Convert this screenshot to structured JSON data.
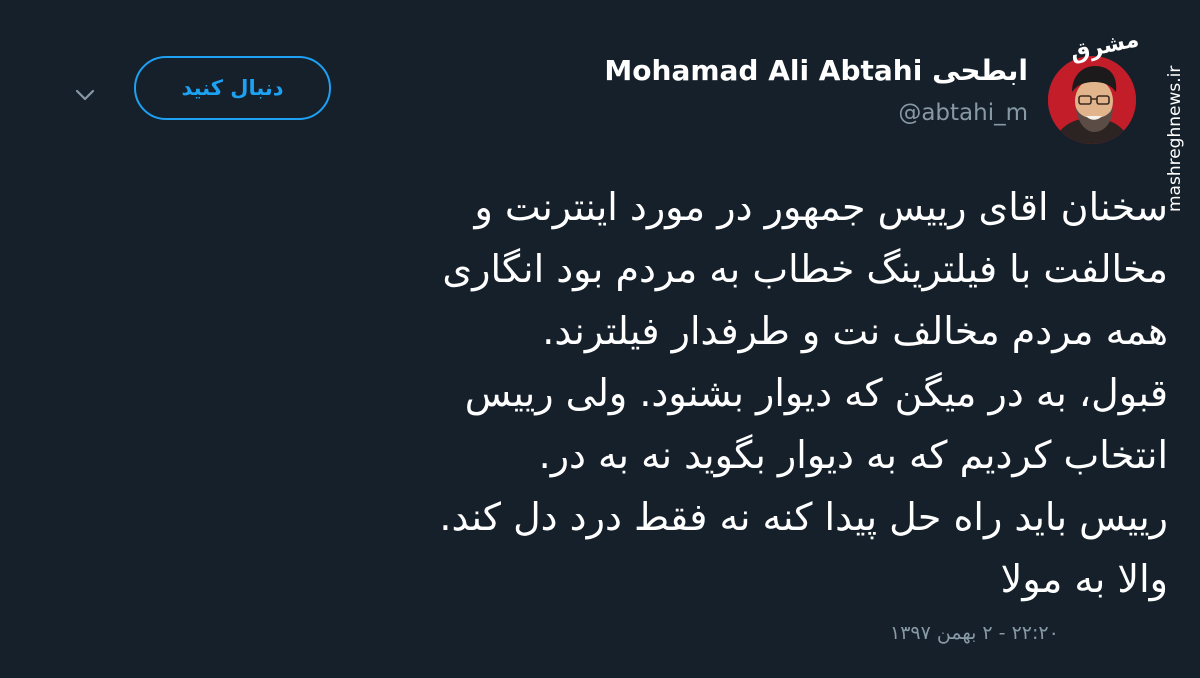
{
  "header": {
    "display_name": "Mohamad Ali Abtahi ابطحی",
    "handle": "@abtahi_m",
    "follow_label": "دنبال کنید"
  },
  "tweet": {
    "lines": [
      "سخنان اقای رییس جمهور در مورد اینترنت و",
      "مخالفت با فیلترینگ خطاب به مردم بود انگاری",
      "همه مردم مخالف نت و طرفدار فیلترند.",
      "قبول، به در میگن که دیوار بشنود. ولی رییس",
      "انتخاب کردیم که به دیوار بگوید نه به در.",
      "رییس باید راه حل پیدا کنه نه فقط درد دل کند.",
      "والا به مولا"
    ],
    "timestamp": "۲۲:۲۰ - ۲ بهمن ۱۳۹۷"
  },
  "watermark": {
    "logo_text": "مشرق",
    "site": "mashreghnews.ir"
  },
  "icons": {
    "caret": "chevron-down-icon",
    "avatar": "profile-photo"
  },
  "colors": {
    "background": "#15202b",
    "accent": "#1da1f2",
    "secondary_text": "#8899a6",
    "text": "#ffffff"
  }
}
